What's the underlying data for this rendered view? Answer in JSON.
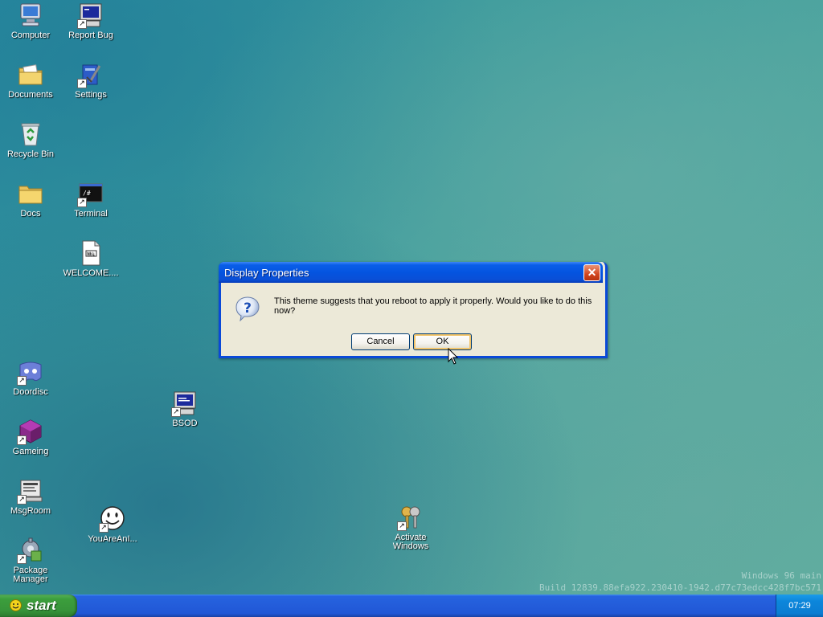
{
  "desktop": {
    "icons": {
      "computer": "Computer",
      "report_bug": "Report Bug",
      "documents": "Documents",
      "settings": "Settings",
      "recycle_bin": "Recycle Bin",
      "docs": "Docs",
      "terminal": "Terminal",
      "welcome": "WELCOME....",
      "doordisc": "Doordisc",
      "gameing": "Gameing",
      "msgroom": "MsgRoom",
      "package_manager": "Package Manager",
      "youareani": "YouAreAnI...",
      "bsod": "BSOD",
      "activate_windows": "Activate Windows"
    },
    "watermark": {
      "line1": "Windows 96 main",
      "line2": "Build 12839.88efa922.230410-1942.d77c73edcc428f7bc571"
    }
  },
  "dialog": {
    "title": "Display Properties",
    "close_glyph": "✕",
    "message": "This theme suggests that you reboot to apply it properly. Would you like to do this now?",
    "cancel_label": "Cancel",
    "ok_label": "OK",
    "icon": "question-icon"
  },
  "taskbar": {
    "start_label": "start",
    "clock": "07:29"
  },
  "colors": {
    "title_bar": "#0454e0",
    "dialog_bg": "#ece9d8",
    "start_green": "#3c9e3c",
    "taskbar_blue": "#245edb"
  }
}
